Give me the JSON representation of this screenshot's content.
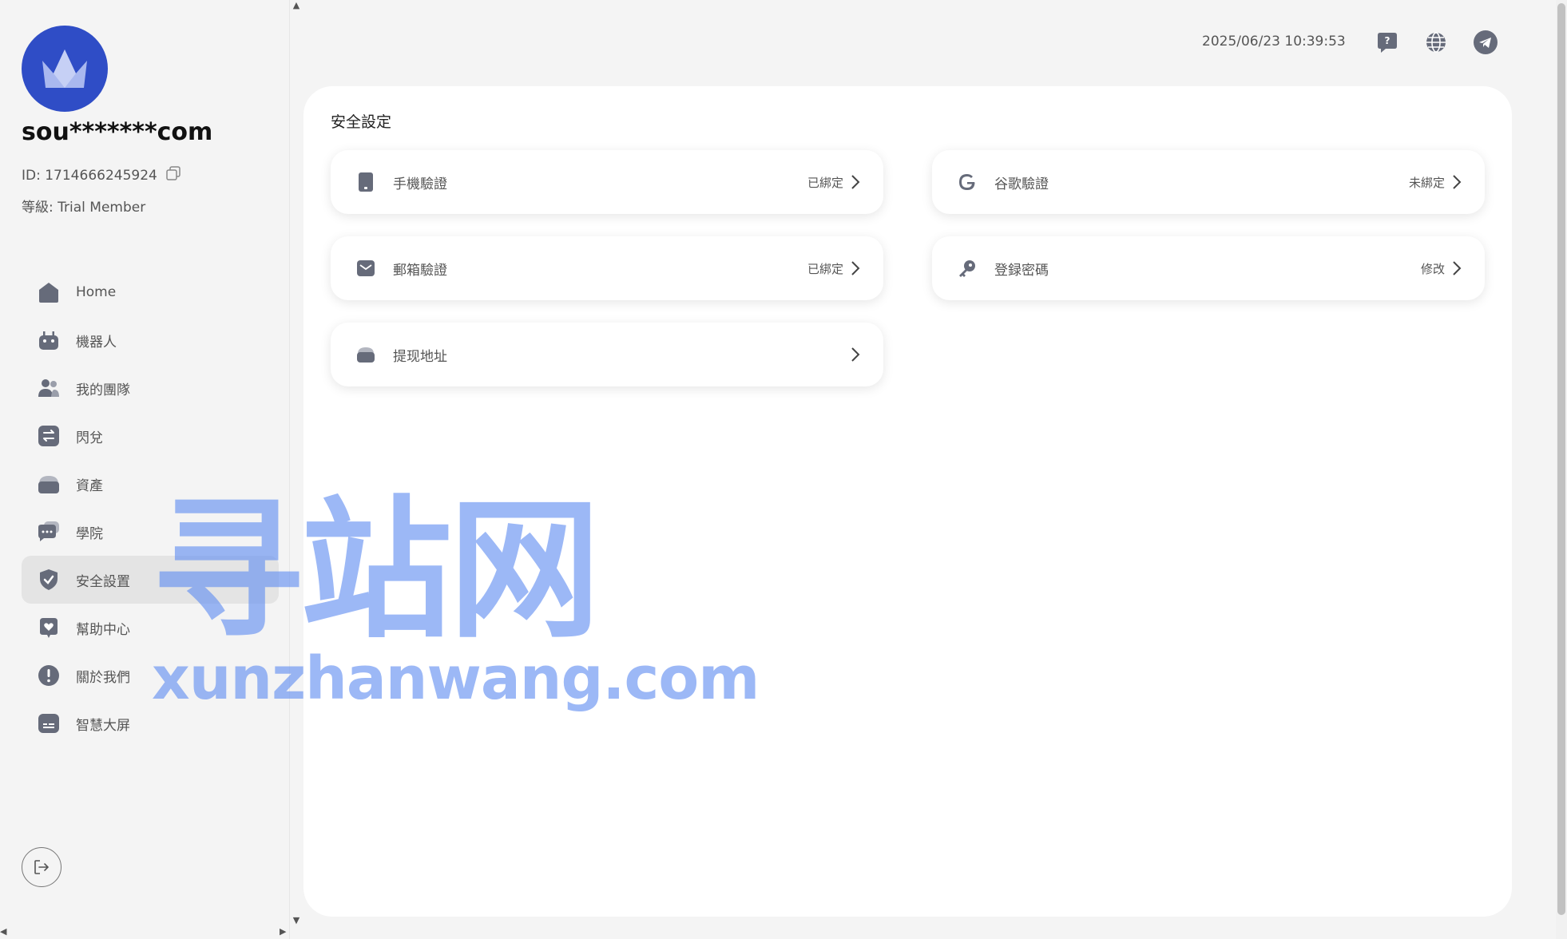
{
  "user": {
    "name": "sou*******com",
    "id_text": "ID: 1714666245924",
    "level_text": "等級: Trial Member"
  },
  "nav": {
    "items": [
      {
        "label": "Home",
        "icon": "home-icon"
      },
      {
        "label": "機器人",
        "icon": "robot-icon"
      },
      {
        "label": "我的團隊",
        "icon": "team-icon"
      },
      {
        "label": "閃兌",
        "icon": "exchange-icon"
      },
      {
        "label": "資產",
        "icon": "wallet-icon"
      },
      {
        "label": "學院",
        "icon": "chat-icon"
      },
      {
        "label": "安全設置",
        "icon": "shield-icon",
        "active": true
      },
      {
        "label": "幫助中心",
        "icon": "help-heart-icon"
      },
      {
        "label": "關於我們",
        "icon": "info-icon"
      },
      {
        "label": "智慧大屏",
        "icon": "screen-icon"
      }
    ]
  },
  "topbar": {
    "datetime": "2025/06/23 10:39:53"
  },
  "security": {
    "title": "安全設定",
    "items": [
      {
        "label": "手機驗證",
        "status": "已綁定",
        "icon": "phone-icon"
      },
      {
        "label": "谷歌驗證",
        "status": "未綁定",
        "icon": "google-icon"
      },
      {
        "label": "郵箱驗證",
        "status": "已綁定",
        "icon": "mail-icon"
      },
      {
        "label": "登録密碼",
        "status": "修改",
        "icon": "key-icon"
      },
      {
        "label": "提现地址",
        "status": "",
        "icon": "wallet-icon"
      }
    ]
  },
  "watermark": {
    "cn": "寻站网",
    "en": "xunzhanwang.com"
  },
  "colors": {
    "accent": "#2f4dc6",
    "icon": "#666b7a",
    "watermark": "#608cf0"
  }
}
